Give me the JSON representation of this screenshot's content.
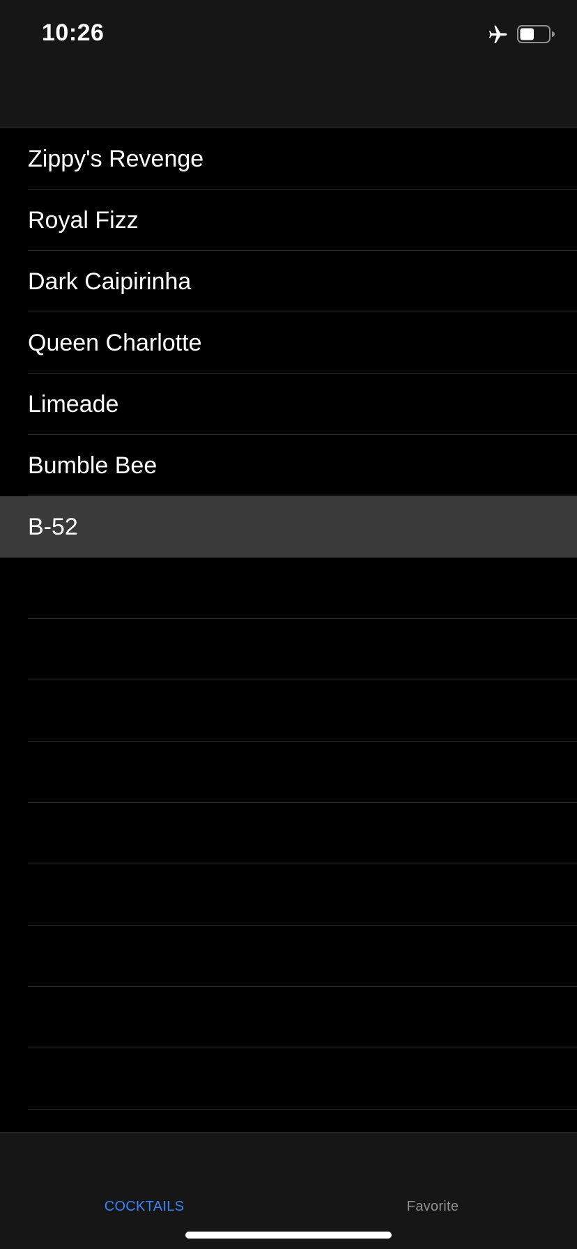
{
  "status_bar": {
    "time": "10:26",
    "airplane_icon": "airplane-icon",
    "battery_icon": "battery-icon",
    "battery_level": 0.5
  },
  "list": {
    "items": [
      {
        "label": "Zippy's Revenge",
        "selected": false
      },
      {
        "label": "Royal Fizz",
        "selected": false
      },
      {
        "label": "Dark Caipirinha",
        "selected": false
      },
      {
        "label": "Queen Charlotte",
        "selected": false
      },
      {
        "label": "Limeade",
        "selected": false
      },
      {
        "label": "Bumble Bee",
        "selected": false
      },
      {
        "label": "B-52",
        "selected": true
      }
    ],
    "empty_rows": 10
  },
  "tab_bar": {
    "tabs": [
      {
        "label": "COCKTAILS",
        "active": true
      },
      {
        "label": "Favorite",
        "active": false
      }
    ]
  },
  "colors": {
    "background": "#000000",
    "bar_background": "#161616",
    "selected_row": "#3a3a3a",
    "separator": "#2c2c2e",
    "tab_active": "#3a82f7",
    "tab_inactive": "#8e8e93",
    "text": "#ffffff"
  }
}
